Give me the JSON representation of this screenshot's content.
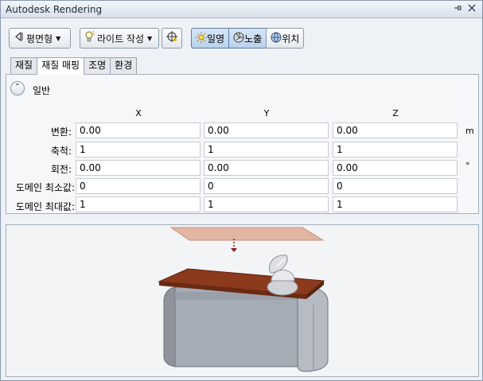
{
  "window": {
    "title": "Autodesk Rendering"
  },
  "titlebar_icons": [
    "pin-icon",
    "close-icon"
  ],
  "toolbar": {
    "view_button": {
      "label": "평면형",
      "icon": "arrow-left-icon"
    },
    "light_button": {
      "label": "라이트 작성",
      "icon": "lightbulb-icon"
    },
    "target_icon": "crosshair-icon",
    "mode_buttons": [
      {
        "label": "일영",
        "icon": "sun-icon",
        "active": true
      },
      {
        "label": "노출",
        "icon": "aperture-icon",
        "active": true
      },
      {
        "label": "위치",
        "icon": "globe-icon",
        "active": false
      }
    ]
  },
  "tabs": [
    {
      "label": "재질",
      "active": false
    },
    {
      "label": "재질 매핑",
      "active": true
    },
    {
      "label": "조명",
      "active": false
    },
    {
      "label": "환경",
      "active": false
    }
  ],
  "section": {
    "label": "일반",
    "collapse_icon": "chevron-up-icon"
  },
  "columns": [
    "X",
    "Y",
    "Z"
  ],
  "rows": [
    {
      "label": "변환:",
      "values": [
        "0.00",
        "0.00",
        "0.00"
      ],
      "unit": "m"
    },
    {
      "label": "축척:",
      "values": [
        "1",
        "1",
        "1"
      ],
      "unit": ""
    },
    {
      "label": "회전:",
      "values": [
        "0.00",
        "0.00",
        "0.00"
      ],
      "unit": "°"
    },
    {
      "label": "도메인 최소값:",
      "values": [
        "0",
        "0",
        "0"
      ],
      "unit": ""
    },
    {
      "label": "도메인 최대값:",
      "values": [
        "1",
        "1",
        "1"
      ],
      "unit": ""
    }
  ],
  "preview": {
    "type": "3d-planar-mapping-preview",
    "colors": {
      "plane": "#e2b6a2",
      "tabletop": "#8b3a1e",
      "body": "#a6acb5"
    }
  }
}
